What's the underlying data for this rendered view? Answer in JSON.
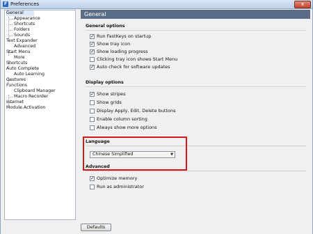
{
  "window": {
    "title": "Preferences",
    "close_label": "x"
  },
  "tree": {
    "items": [
      {
        "label": "General"
      },
      {
        "label": "Appearance"
      },
      {
        "label": "Shortcuts"
      },
      {
        "label": "Folders"
      },
      {
        "label": "Sounds"
      },
      {
        "label": "Text Expander"
      },
      {
        "label": "Advanced"
      },
      {
        "label": "Start Menu"
      },
      {
        "label": "More"
      },
      {
        "label": "Shortcuts"
      },
      {
        "label": "Auto Complete"
      },
      {
        "label": "Auto Learning"
      },
      {
        "label": "Gestures"
      },
      {
        "label": "Functions"
      },
      {
        "label": "Clipboard Manager"
      },
      {
        "label": "Macro Recorder"
      },
      {
        "label": "Internet"
      },
      {
        "label": "Module Activation"
      }
    ]
  },
  "panel": {
    "header": "General",
    "general_options": {
      "title": "General options",
      "items": [
        {
          "label": "Run FastKeys on startup",
          "checked": true
        },
        {
          "label": "Show tray icon",
          "checked": true
        },
        {
          "label": "Show loading progress",
          "checked": true
        },
        {
          "label": "Clicking tray icon shows Start Menu",
          "checked": false
        },
        {
          "label": "Auto check for software updates",
          "checked": true
        }
      ]
    },
    "display_options": {
      "title": "Display options",
      "items": [
        {
          "label": "Show stripes",
          "checked": true
        },
        {
          "label": "Show grids",
          "checked": false
        },
        {
          "label": "Display Apply, Edit, Delete buttons",
          "checked": false
        },
        {
          "label": "Enable column sorting",
          "checked": false
        },
        {
          "label": "Always show more options",
          "checked": false
        }
      ]
    },
    "language": {
      "title": "Language",
      "selected": "Chinese Simplified"
    },
    "advanced": {
      "title": "Advanced",
      "items": [
        {
          "label": "Optimize memory",
          "checked": true
        },
        {
          "label": "Run as administrator",
          "checked": false
        }
      ]
    }
  },
  "footer": {
    "defaults_label": "Defaults"
  }
}
